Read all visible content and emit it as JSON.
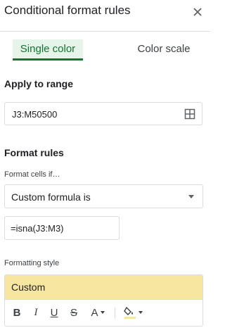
{
  "header": {
    "title": "Conditional format rules"
  },
  "tabs": [
    {
      "label": "Single color",
      "selected": true
    },
    {
      "label": "Color scale",
      "selected": false
    }
  ],
  "apply_range": {
    "label": "Apply to range",
    "value": "J3:M50500"
  },
  "format_rules": {
    "label": "Format rules",
    "condition_label": "Format cells if…",
    "condition_value": "Custom formula is",
    "formula_value": "=isna(J3:M3)"
  },
  "formatting_style": {
    "label": "Formatting style",
    "preview_text": "Custom",
    "preview_color": "#f6e6a0",
    "toolbar": {
      "bold": "B",
      "italic": "I",
      "underline": "U",
      "strikethrough": "S",
      "text_color": "A",
      "fill_color_underline": "#f6e6a0"
    }
  },
  "colors": {
    "accent_green": "#137333",
    "selected_tab_bg": "#e6f4ea",
    "border": "#dadce0"
  }
}
